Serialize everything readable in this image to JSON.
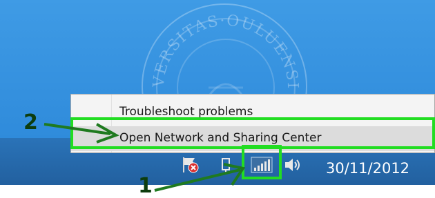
{
  "context_menu": {
    "items": [
      {
        "label": "Troubleshoot problems"
      },
      {
        "label": "Open Network and Sharing Center"
      }
    ]
  },
  "taskbar": {
    "clock": "30/11/2012",
    "tray_icons": [
      "action-center-flag-icon",
      "pin-icon",
      "network-signal-icon",
      "speaker-icon"
    ]
  },
  "annotations": {
    "step_1": "1",
    "step_2": "2",
    "highlight_color": "#22dd22"
  },
  "colors": {
    "desktop": "#3f9be5",
    "taskbar": "#2a73b8",
    "menu_bg": "#f4f4f4",
    "menu_hover": "#dcdcdc"
  }
}
